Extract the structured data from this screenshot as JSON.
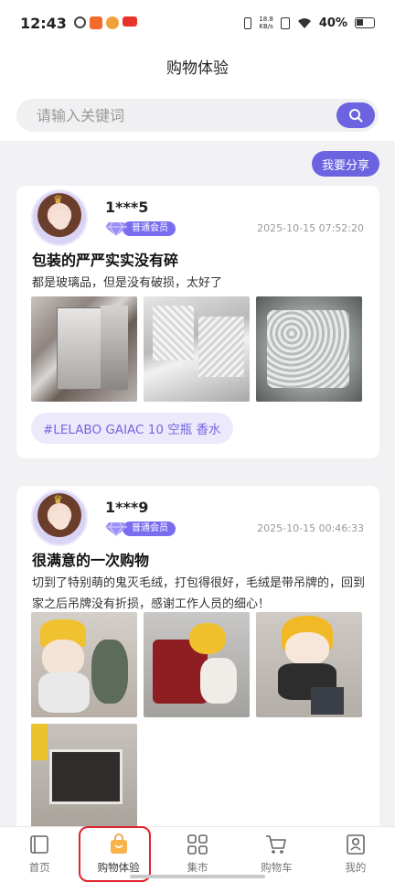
{
  "status_bar": {
    "time": "12:43",
    "net_speed_value": "18.8",
    "net_speed_unit": "KB/s",
    "battery": "40%"
  },
  "header": {
    "title": "购物体验"
  },
  "search": {
    "placeholder": "请输入关键词"
  },
  "share_button": "我要分享",
  "posts": [
    {
      "username": "1***5",
      "member_level": "普通会员",
      "date": "2025-10-15 07:52:20",
      "title": "包装的严严实实没有碎",
      "body": "都是玻璃品，但是没有破损，太好了",
      "tag": "#LELABO GAIAC 10 空瓶 香水"
    },
    {
      "username": "1***9",
      "member_level": "普通会员",
      "date": "2025-10-15 00:46:33",
      "title": "很满意的一次购物",
      "body": "切到了特别萌的鬼灭毛绒，打包得很好，毛绒是带吊牌的，回到家之后吊牌没有折损，感谢工作人员的细心！"
    }
  ],
  "tab_bar": {
    "items": [
      {
        "label": "首页",
        "icon": "book-icon"
      },
      {
        "label": "购物体验",
        "icon": "shopping-bag-icon"
      },
      {
        "label": "集市",
        "icon": "grid-icon"
      },
      {
        "label": "购物车",
        "icon": "cart-icon"
      },
      {
        "label": "我的",
        "icon": "profile-icon"
      }
    ],
    "active": "购物体验"
  },
  "colors": {
    "accent": "#6c63e0",
    "tag_bg": "#ece9fb",
    "highlight": "#e0222a"
  }
}
